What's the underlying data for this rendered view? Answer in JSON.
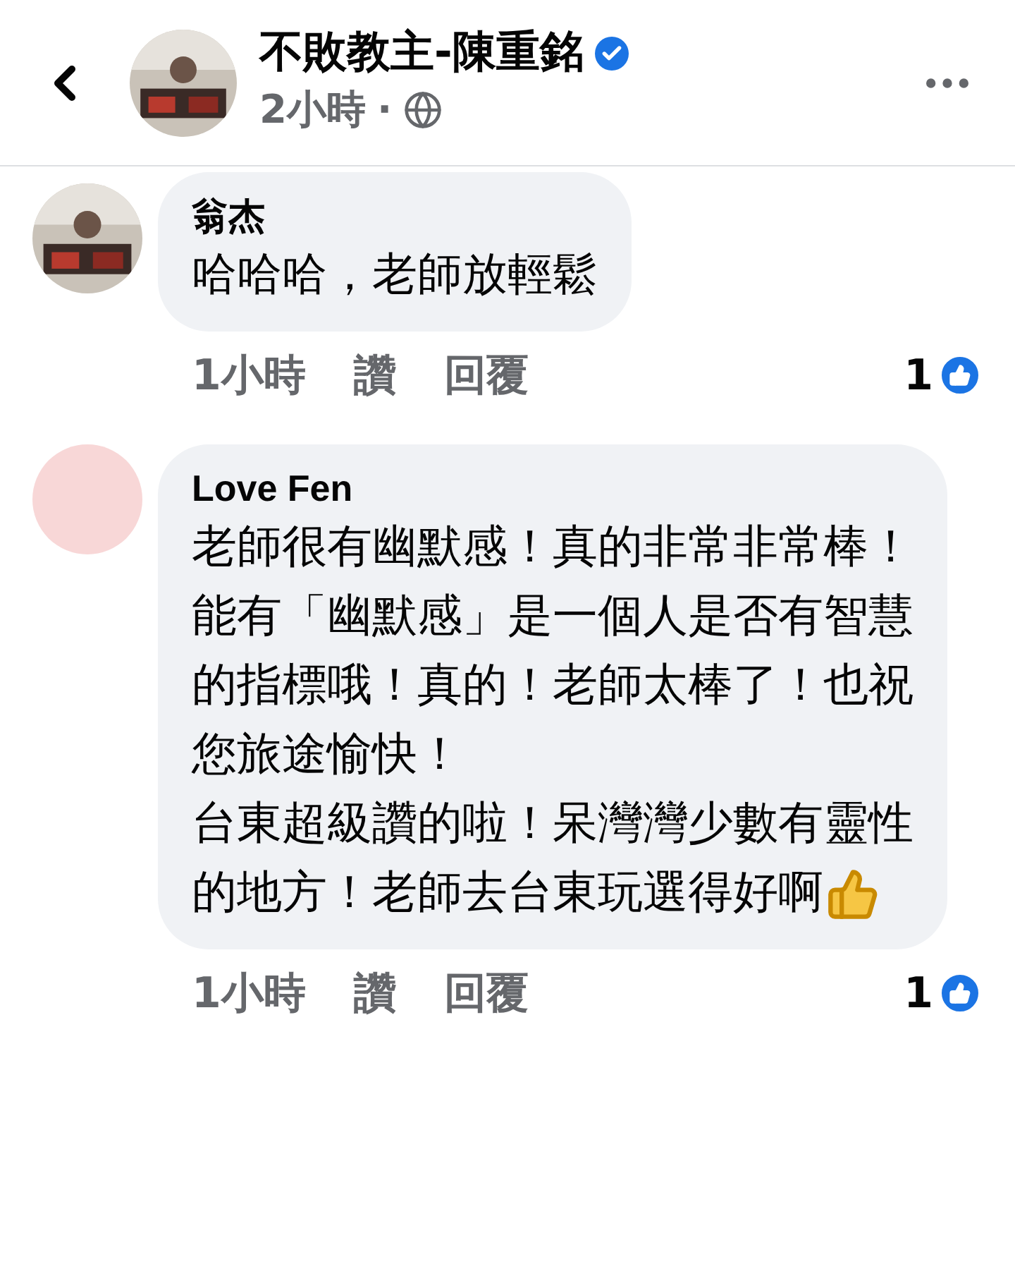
{
  "header": {
    "page_name": "不敗教主-陳重銘",
    "verified": true,
    "time": "2小時",
    "separator": "·"
  },
  "comments": [
    {
      "author": "翁杰",
      "avatar": {
        "kind": "picture"
      },
      "paragraphs": [
        "哈哈哈，老師放輕鬆"
      ],
      "emoji": false,
      "time": "1小時",
      "like": "讚",
      "reply": "回覆",
      "like_count": "1"
    },
    {
      "author": "Love Fen",
      "avatar": {
        "kind": "blank"
      },
      "paragraphs": [
        "老師很有幽默感！真的非常非常棒！",
        "能有「幽默感」是一個人是否有智慧的指標哦！真的！老師太棒了！也祝您旅途愉快！",
        "台東超級讚的啦！呆灣灣少數有靈性的地方！老師去台東玩選得好啊"
      ],
      "emoji": true,
      "time": "1小時",
      "like": "讚",
      "reply": "回覆",
      "like_count": "1"
    }
  ]
}
